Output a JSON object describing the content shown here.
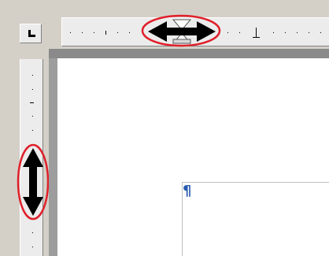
{
  "editor": {
    "paragraph_mark": "¶"
  },
  "icons": {
    "tab_stop": "left-tab-stop-icon",
    "horizontal_drag": "horizontal-resize-arrow-icon",
    "vertical_drag": "vertical-resize-arrow-icon",
    "indent_markers": "indent-marker-icon"
  },
  "colors": {
    "highlight": "#e0202a",
    "ruler_bg": "#ececec",
    "chrome_bg": "#d4d0c8",
    "page_bg": "#ffffff",
    "margin_shadow": "#9d9d9d",
    "pilcrow": "#2a5bb0"
  }
}
